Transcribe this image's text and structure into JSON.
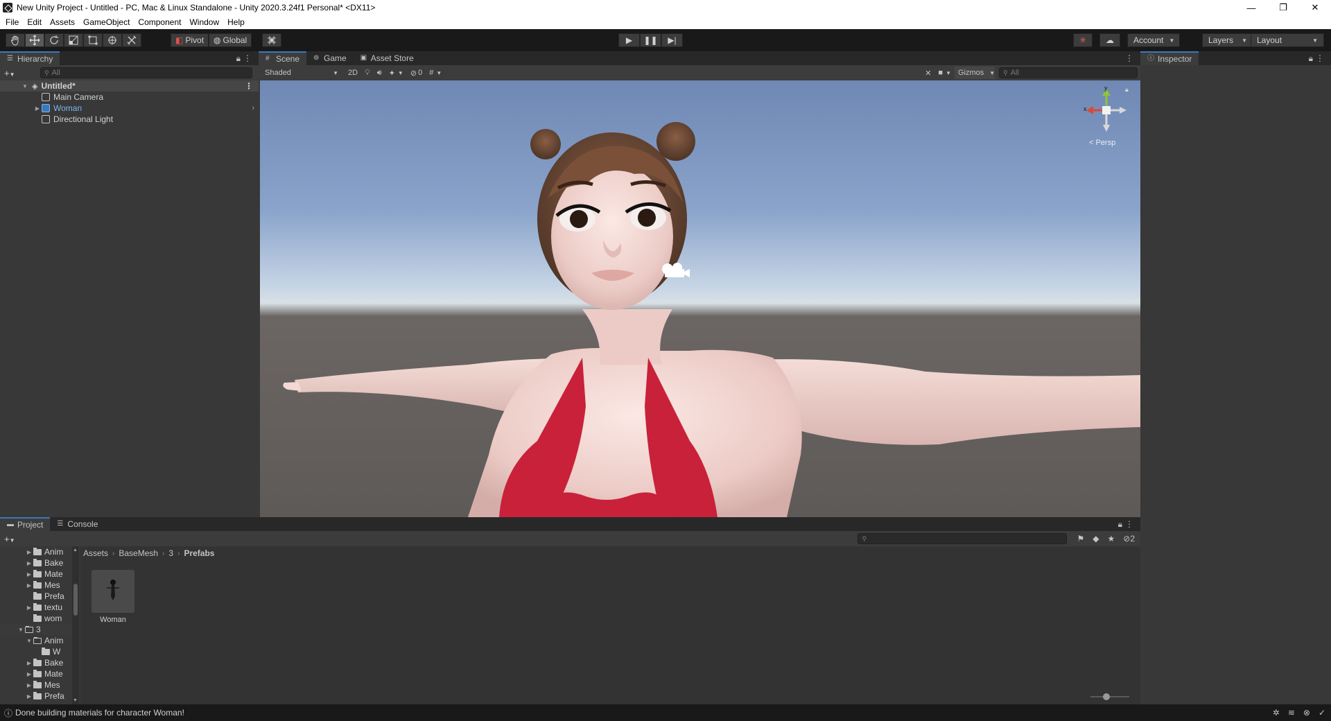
{
  "window": {
    "title": "New Unity Project - Untitled - PC, Mac & Linux Standalone - Unity 2020.3.24f1 Personal* <DX11>",
    "minimize": "—",
    "maximize": "❐",
    "close": "✕"
  },
  "menu": [
    "File",
    "Edit",
    "Assets",
    "GameObject",
    "Component",
    "Window",
    "Help"
  ],
  "toolbar": {
    "pivot_label": "Pivot",
    "global_label": "Global",
    "account_label": "Account",
    "layers_label": "Layers",
    "layout_label": "Layout"
  },
  "hierarchy": {
    "tab_label": "Hierarchy",
    "search_placeholder": "All",
    "scene_name": "Untitled*",
    "items": [
      {
        "label": "Main Camera"
      },
      {
        "label": "Woman"
      },
      {
        "label": "Directional Light"
      }
    ]
  },
  "scene": {
    "tabs": [
      "Scene",
      "Game",
      "Asset Store"
    ],
    "shading_mode": "Shaded",
    "toggle_2d": "2D",
    "hidden_count": "0",
    "gizmos_label": "Gizmos",
    "search_placeholder": "All",
    "axis_x": "x",
    "axis_y": "y",
    "projection": "< Persp"
  },
  "inspector": {
    "tab_label": "Inspector"
  },
  "project": {
    "tabs": [
      "Project",
      "Console"
    ],
    "hidden_count": "2",
    "breadcrumb": [
      "Assets",
      "BaseMesh",
      "3",
      "Prefabs"
    ],
    "tree": [
      {
        "label": "Anim",
        "indent": 2,
        "expanded": false
      },
      {
        "label": "Bake",
        "indent": 2,
        "expanded": false
      },
      {
        "label": "Mate",
        "indent": 2,
        "expanded": false
      },
      {
        "label": "Mes",
        "indent": 2,
        "expanded": false
      },
      {
        "label": "Prefa",
        "indent": 2,
        "expanded": null
      },
      {
        "label": "textu",
        "indent": 2,
        "expanded": false
      },
      {
        "label": "wom",
        "indent": 2,
        "expanded": null
      },
      {
        "label": "3",
        "indent": 1,
        "expanded": true
      },
      {
        "label": "Anim",
        "indent": 2,
        "expanded": true
      },
      {
        "label": "W",
        "indent": 3,
        "expanded": null
      },
      {
        "label": "Bake",
        "indent": 2,
        "expanded": false
      },
      {
        "label": "Mate",
        "indent": 2,
        "expanded": false
      },
      {
        "label": "Mes",
        "indent": 2,
        "expanded": false
      },
      {
        "label": "Prefa",
        "indent": 2,
        "expanded": false
      }
    ],
    "assets": [
      {
        "label": "Woman"
      }
    ],
    "zoom_level": 0.4
  },
  "status": {
    "message": "Done building materials for character Woman!"
  },
  "colors": {
    "accent": "#3a79bb",
    "selected_object": "#7cb5ec",
    "dress": "#c9213a"
  }
}
